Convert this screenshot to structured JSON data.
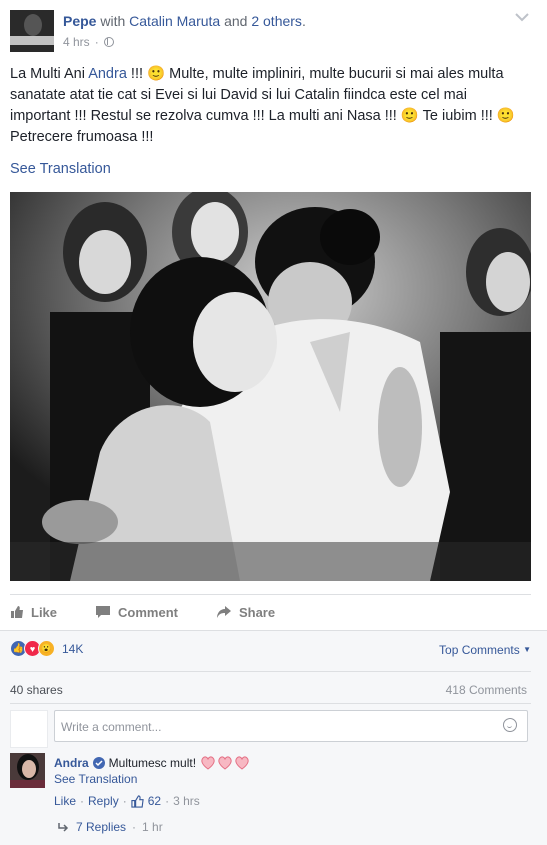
{
  "header": {
    "author": "Pepe",
    "with_word": "with",
    "tagged": "Catalin Maruta",
    "and_word": "and",
    "others": "2 others",
    "period": ".",
    "time": "4 hrs",
    "dot": "·"
  },
  "post": {
    "text_part1": "La Multi Ani ",
    "mention": "Andra",
    "text_part2": " !!! 🙂 Multe, multe impliniri, multe bucurii si mai ales multa sanatate atat tie cat si Evei si lui David si lui Catalin fiindca este cel mai important !!! Restul se rezolva cumva !!! La multi ani Nasa !!! 🙂 Te iubim !!! 🙂 Petrecere frumoasa !!!",
    "see_translation": "See Translation"
  },
  "actions": {
    "like": "Like",
    "comment": "Comment",
    "share": "Share"
  },
  "stats": {
    "reactions_count": "14K",
    "top_comments": "Top Comments",
    "shares": "40 shares",
    "comments": "418 Comments"
  },
  "comment_box": {
    "placeholder": "Write a comment..."
  },
  "comment": {
    "author": "Andra",
    "text": "Multumesc mult!",
    "see_translation": "See Translation",
    "like": "Like",
    "reply": "Reply",
    "likes_count": "62",
    "time": "3 hrs",
    "sep": "·",
    "replies": "7 Replies",
    "replies_time": "1 hr"
  },
  "colors": {
    "link": "#365899",
    "muted": "#90949c",
    "like_blue": "#4267b2",
    "love_red": "#f0284a",
    "wow_yellow": "#f7b125"
  }
}
